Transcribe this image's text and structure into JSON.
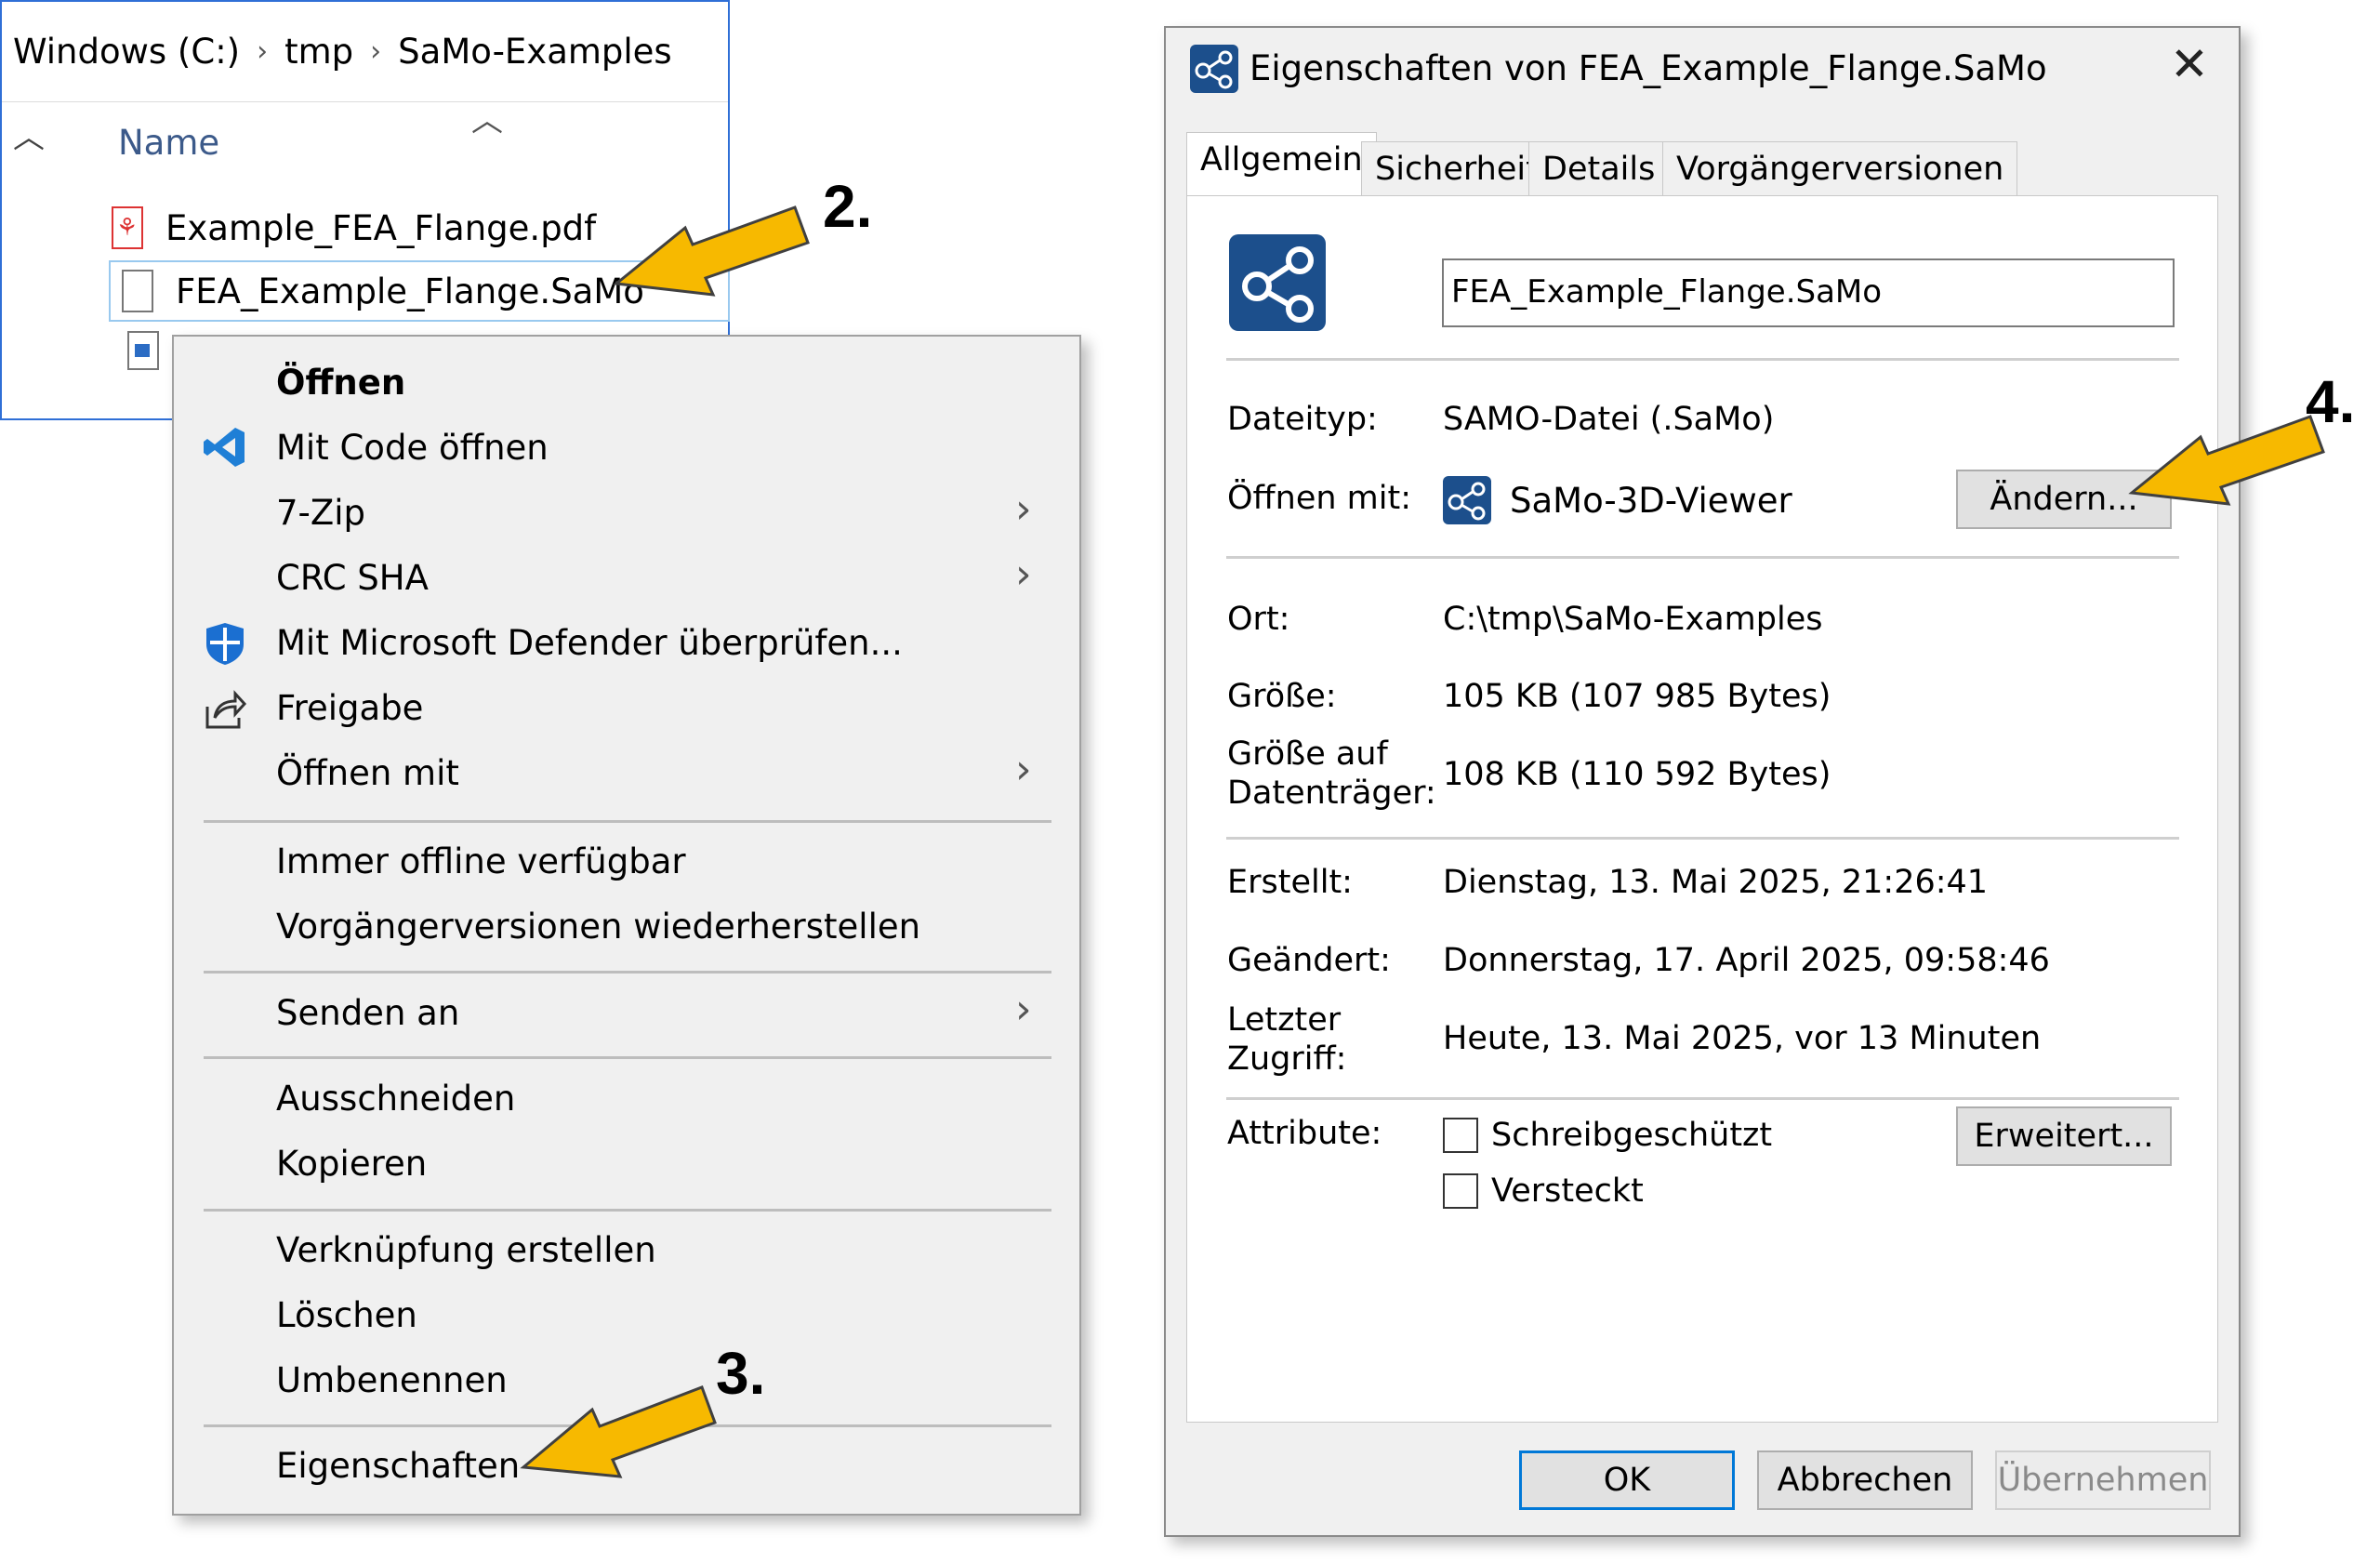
{
  "explorer": {
    "breadcrumb": [
      "Windows (C:)",
      "tmp",
      "SaMo-Examples"
    ],
    "breadcrumb_separator": "›",
    "column_name": "Name",
    "files": [
      {
        "name": "Example_FEA_Flange.pdf",
        "icon": "pdf-file-icon"
      },
      {
        "name": "FEA_Example_Flange.SaMo",
        "icon": "samo-file-icon",
        "selected": true
      }
    ]
  },
  "context_menu": {
    "items": [
      {
        "label": "Öffnen",
        "bold": true
      },
      {
        "label": "Mit Code öffnen",
        "icon": "vscode-icon"
      },
      {
        "label": "7-Zip",
        "submenu": true
      },
      {
        "label": "CRC SHA",
        "submenu": true
      },
      {
        "label": "Mit Microsoft Defender überprüfen...",
        "icon": "defender-shield-icon"
      },
      {
        "label": "Freigabe",
        "icon": "share-icon"
      },
      {
        "label": "Öffnen mit",
        "submenu": true
      },
      {
        "label": "Immer offline verfügbar"
      },
      {
        "label": "Vorgängerversionen wiederherstellen"
      },
      {
        "label": "Senden an",
        "submenu": true
      },
      {
        "label": "Ausschneiden"
      },
      {
        "label": "Kopieren"
      },
      {
        "label": "Verknüpfung erstellen"
      },
      {
        "label": "Löschen"
      },
      {
        "label": "Umbenennen"
      },
      {
        "label": "Eigenschaften"
      }
    ]
  },
  "dialog": {
    "title": "Eigenschaften von FEA_Example_Flange.SaMo",
    "tabs": [
      "Allgemein",
      "Sicherheit",
      "Details",
      "Vorgängerversionen"
    ],
    "active_tab": "Allgemein",
    "filename": "FEA_Example_Flange.SaMo",
    "labels": {
      "dateityp": "Dateityp:",
      "oeffnen_mit": "Öffnen mit:",
      "ort": "Ort:",
      "groesse": "Größe:",
      "groesse_auf_1": "Größe auf",
      "groesse_auf_2": "Datenträger:",
      "erstellt": "Erstellt:",
      "geaendert": "Geändert:",
      "letzter_1": "Letzter",
      "letzter_2": "Zugriff:",
      "attribute": "Attribute:"
    },
    "values": {
      "dateityp": "SAMO-Datei (.SaMo)",
      "oeffnen_mit": "SaMo-3D-Viewer",
      "ort": "C:\\tmp\\SaMo-Examples",
      "groesse": "105 KB (107 985 Bytes)",
      "groesse_auf": "108 KB (110 592 Bytes)",
      "erstellt": "Dienstag, 13. Mai 2025, 21:26:41",
      "geaendert": "Donnerstag, 17. April 2025, 09:58:46",
      "letzter_zugriff": "Heute, 13. Mai 2025, vor 13 Minuten"
    },
    "attributes": {
      "schreibgeschuetzt": "Schreibgeschützt",
      "versteckt": "Versteckt"
    },
    "buttons": {
      "aendern": "Ändern...",
      "erweitert": "Erweitert...",
      "ok": "OK",
      "abbrechen": "Abbrechen",
      "uebernehmen": "Übernehmen"
    },
    "close": "✕"
  },
  "annotations": {
    "step2": "2.",
    "step3": "3.",
    "step4": "4."
  },
  "colors": {
    "arrow_fill": "#f7b900",
    "arrow_stroke": "#404040",
    "samo_icon_bg": "#1c4f8c",
    "selection_border": "#99c9ef"
  }
}
